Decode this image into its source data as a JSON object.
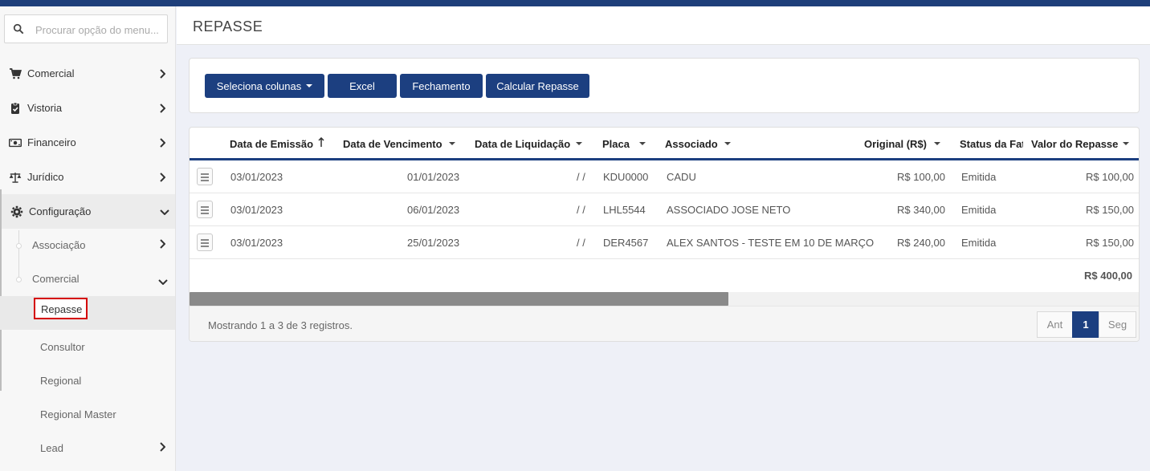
{
  "search": {
    "placeholder": "Procurar opção do menu..."
  },
  "page": {
    "title": "REPASSE"
  },
  "sidebar": {
    "items": [
      {
        "label": "Comercial"
      },
      {
        "label": "Vistoria"
      },
      {
        "label": "Financeiro"
      },
      {
        "label": "Jurídico"
      },
      {
        "label": "Configuração"
      }
    ],
    "sub": [
      {
        "label": "Associação"
      },
      {
        "label": "Comercial"
      }
    ],
    "sub2": [
      {
        "label": "Repasse"
      },
      {
        "label": "Consultor"
      },
      {
        "label": "Regional"
      },
      {
        "label": "Regional Master"
      },
      {
        "label": "Lead"
      }
    ]
  },
  "toolbar": {
    "select_columns": "Seleciona colunas",
    "excel": "Excel",
    "fechamento": "Fechamento",
    "calcular": "Calcular Repasse"
  },
  "table": {
    "headers": {
      "emissao": "Data de Emissão",
      "vencimento": "Data de Vencimento",
      "liquidacao": "Data de Liquidação",
      "placa": "Placa",
      "associado": "Associado",
      "original": "Original (R$)",
      "status": "Status da Fatura",
      "repasse": "Valor do Repasse"
    },
    "rows": [
      {
        "emissao": "03/01/2023",
        "vencimento": "01/01/2023",
        "liquidacao": "/ /",
        "placa": "KDU0000",
        "associado": "CADU",
        "original": "R$ 100,00",
        "status": "Emitida",
        "repasse": "R$ 100,00"
      },
      {
        "emissao": "03/01/2023",
        "vencimento": "06/01/2023",
        "liquidacao": "/ /",
        "placa": "LHL5544",
        "associado": "ASSOCIADO JOSE NETO",
        "original": "R$ 340,00",
        "status": "Emitida",
        "repasse": "R$ 150,00"
      },
      {
        "emissao": "03/01/2023",
        "vencimento": "25/01/2023",
        "liquidacao": "/ /",
        "placa": "DER4567",
        "associado": "ALEX SANTOS - TESTE EM 10 DE MARÇO",
        "original": "R$ 240,00",
        "status": "Emitida",
        "repasse": "R$ 150,00"
      }
    ],
    "total": "R$ 400,00"
  },
  "footer": {
    "info": "Mostrando 1 a 3 de 3 registros.",
    "prev": "Ant",
    "current": "1",
    "next": "Seg"
  }
}
